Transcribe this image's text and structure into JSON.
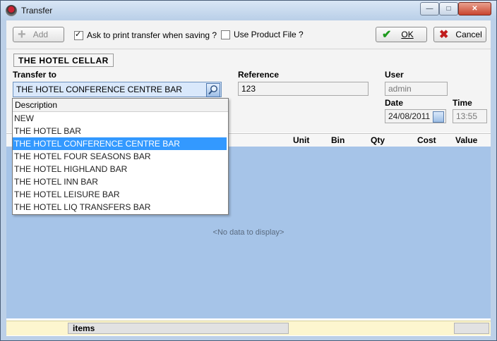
{
  "window": {
    "title": "Transfer",
    "controls": [
      "minimize-icon",
      "maximize-icon",
      "close-icon"
    ]
  },
  "toolbar": {
    "add_label": "Add",
    "ask_print_label": "Ask to print transfer when saving ?",
    "ask_print_checked": true,
    "use_product_file_label": "Use Product File ?",
    "use_product_file_checked": false,
    "ok_label": "OK",
    "cancel_label": "Cancel"
  },
  "form": {
    "source_location": "THE HOTEL  CELLAR",
    "transfer_to_label": "Transfer to",
    "transfer_to_value": "THE HOTEL CONFERENCE CENTRE BAR",
    "reference_label": "Reference",
    "reference_value": "123",
    "user_label": "User",
    "user_value": "admin",
    "date_label": "Date",
    "date_value": "24/08/2011",
    "time_label": "Time",
    "time_value": "13:55"
  },
  "grid": {
    "columns": [
      "Unit",
      "Bin",
      "Qty",
      "Cost",
      "Value"
    ],
    "empty_text": "<No data to display>"
  },
  "status": {
    "items_label": "items"
  },
  "dropdown": {
    "header": "Description",
    "items": [
      "NEW",
      "THE HOTEL BAR",
      "THE HOTEL CONFERENCE CENTRE BAR",
      "THE HOTEL FOUR SEASONS BAR",
      "THE HOTEL HIGHLAND BAR",
      "THE HOTEL INN BAR",
      "THE HOTEL LEISURE BAR",
      "THE HOTEL LIQ TRANSFERS BAR"
    ],
    "selected_index": 2
  },
  "colors": {
    "selection": "#3399ff",
    "grid_bg": "#a6c4e8",
    "status_bg": "#fdf6cf"
  }
}
